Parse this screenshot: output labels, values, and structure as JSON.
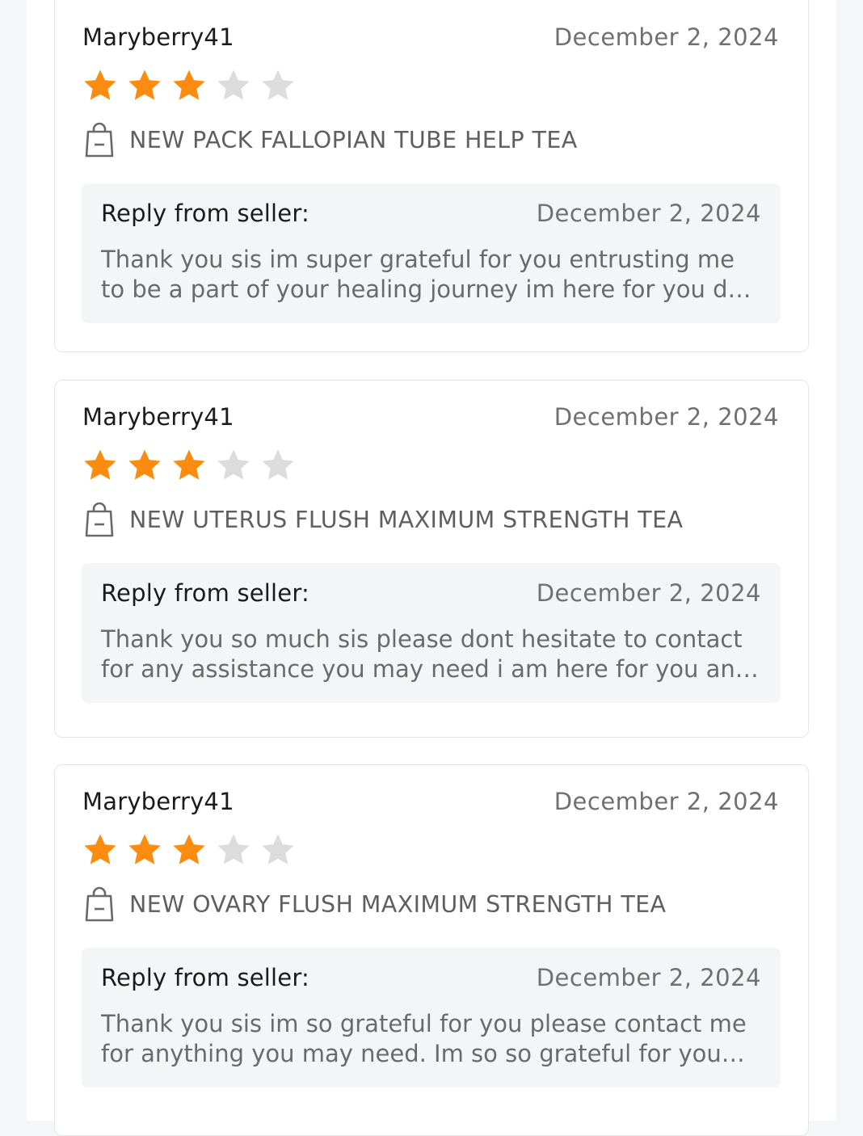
{
  "colors": {
    "star_filled": "#fb8c10",
    "star_empty": "#dcdcdc",
    "reply_bg": "#f4f5f7"
  },
  "reviews": [
    {
      "reviewer": "Maryberry41",
      "date": "December 2, 2024",
      "rating": 3,
      "max_rating": 5,
      "product_icon": "shopping-bag-icon",
      "product": "NEW PACK FALLOPIAN TUBE HELP TEA",
      "reply": {
        "label": "Reply from seller:",
        "date": "December 2, 2024",
        "text": "Thank you sis im super grateful for you entrusting me to be a part of your healing journey im here for you day or n..."
      }
    },
    {
      "reviewer": "Maryberry41",
      "date": "December 2, 2024",
      "rating": 3,
      "max_rating": 5,
      "product_icon": "shopping-bag-icon",
      "product": "NEW UTERUS FLUSH MAXIMUM STRENGTH TEA",
      "reply": {
        "label": "Reply from seller:",
        "date": "December 2, 2024",
        "text": "Thank you so much sis please dont hesitate to contact for any assistance you may need i am here for you and soo ..."
      }
    },
    {
      "reviewer": "Maryberry41",
      "date": "December 2, 2024",
      "rating": 3,
      "max_rating": 5,
      "product_icon": "shopping-bag-icon",
      "product": "NEW OVARY FLUSH MAXIMUM STRENGTH TEA",
      "reply": {
        "label": "Reply from seller:",
        "date": "December 2, 2024",
        "text": "Thank you sis im so grateful for you please contact me for anything you may need. Im so so grateful for you allowin..."
      }
    }
  ]
}
